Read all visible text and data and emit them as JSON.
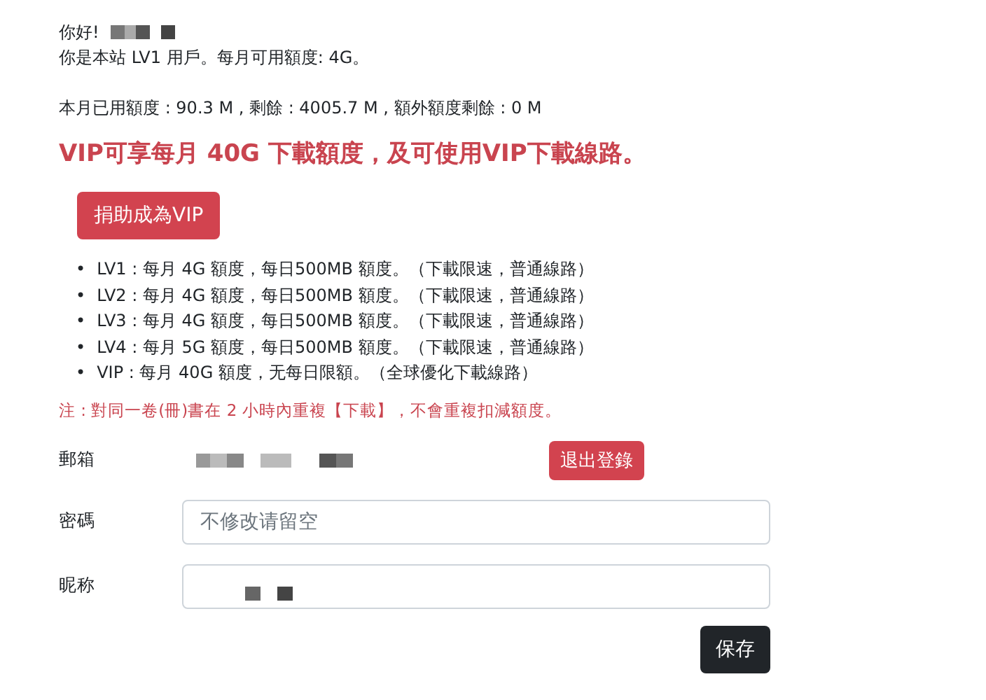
{
  "greeting": "你好!",
  "level_line": "你是本站 LV1 用戶。每月可用額度: 4G。",
  "usage_line": "本月已用額度 : 90.3 M , 剩餘 : 4005.7 M , 額外額度剩餘 : 0 M",
  "vip_headline": "VIP可享每月 40G 下載額度，及可使用VIP下載線路。",
  "donate_button": "捐助成為VIP",
  "levels": [
    {
      "marker": "•",
      "text": "LV1 : 每月 4G 額度，每日500MB 額度。（下載限速，普通線路）"
    },
    {
      "marker": "•",
      "text": "LV2 : 每月 4G 額度，每日500MB 額度。（下載限速，普通線路）"
    },
    {
      "marker": "•",
      "text": "LV3 : 每月 4G 額度，每日500MB 額度。（下載限速，普通線路）"
    },
    {
      "marker": "•",
      "text": "LV4 : 每月 5G 額度，每日500MB 額度。（下載限速，普通線路）"
    },
    {
      "marker": "•",
      "text": "VIP : 每月 40G 額度，无每日限額。（全球優化下載線路）"
    }
  ],
  "note": "注 : 對同一卷(冊)書在 2 小時內重複【下載】，不會重複扣減額度。",
  "form": {
    "email_label": "郵箱",
    "logout_button": "退出登錄",
    "password_label": "密碼",
    "password_placeholder": "不修改请留空",
    "nickname_label": "昵称",
    "save_button": "保存"
  }
}
